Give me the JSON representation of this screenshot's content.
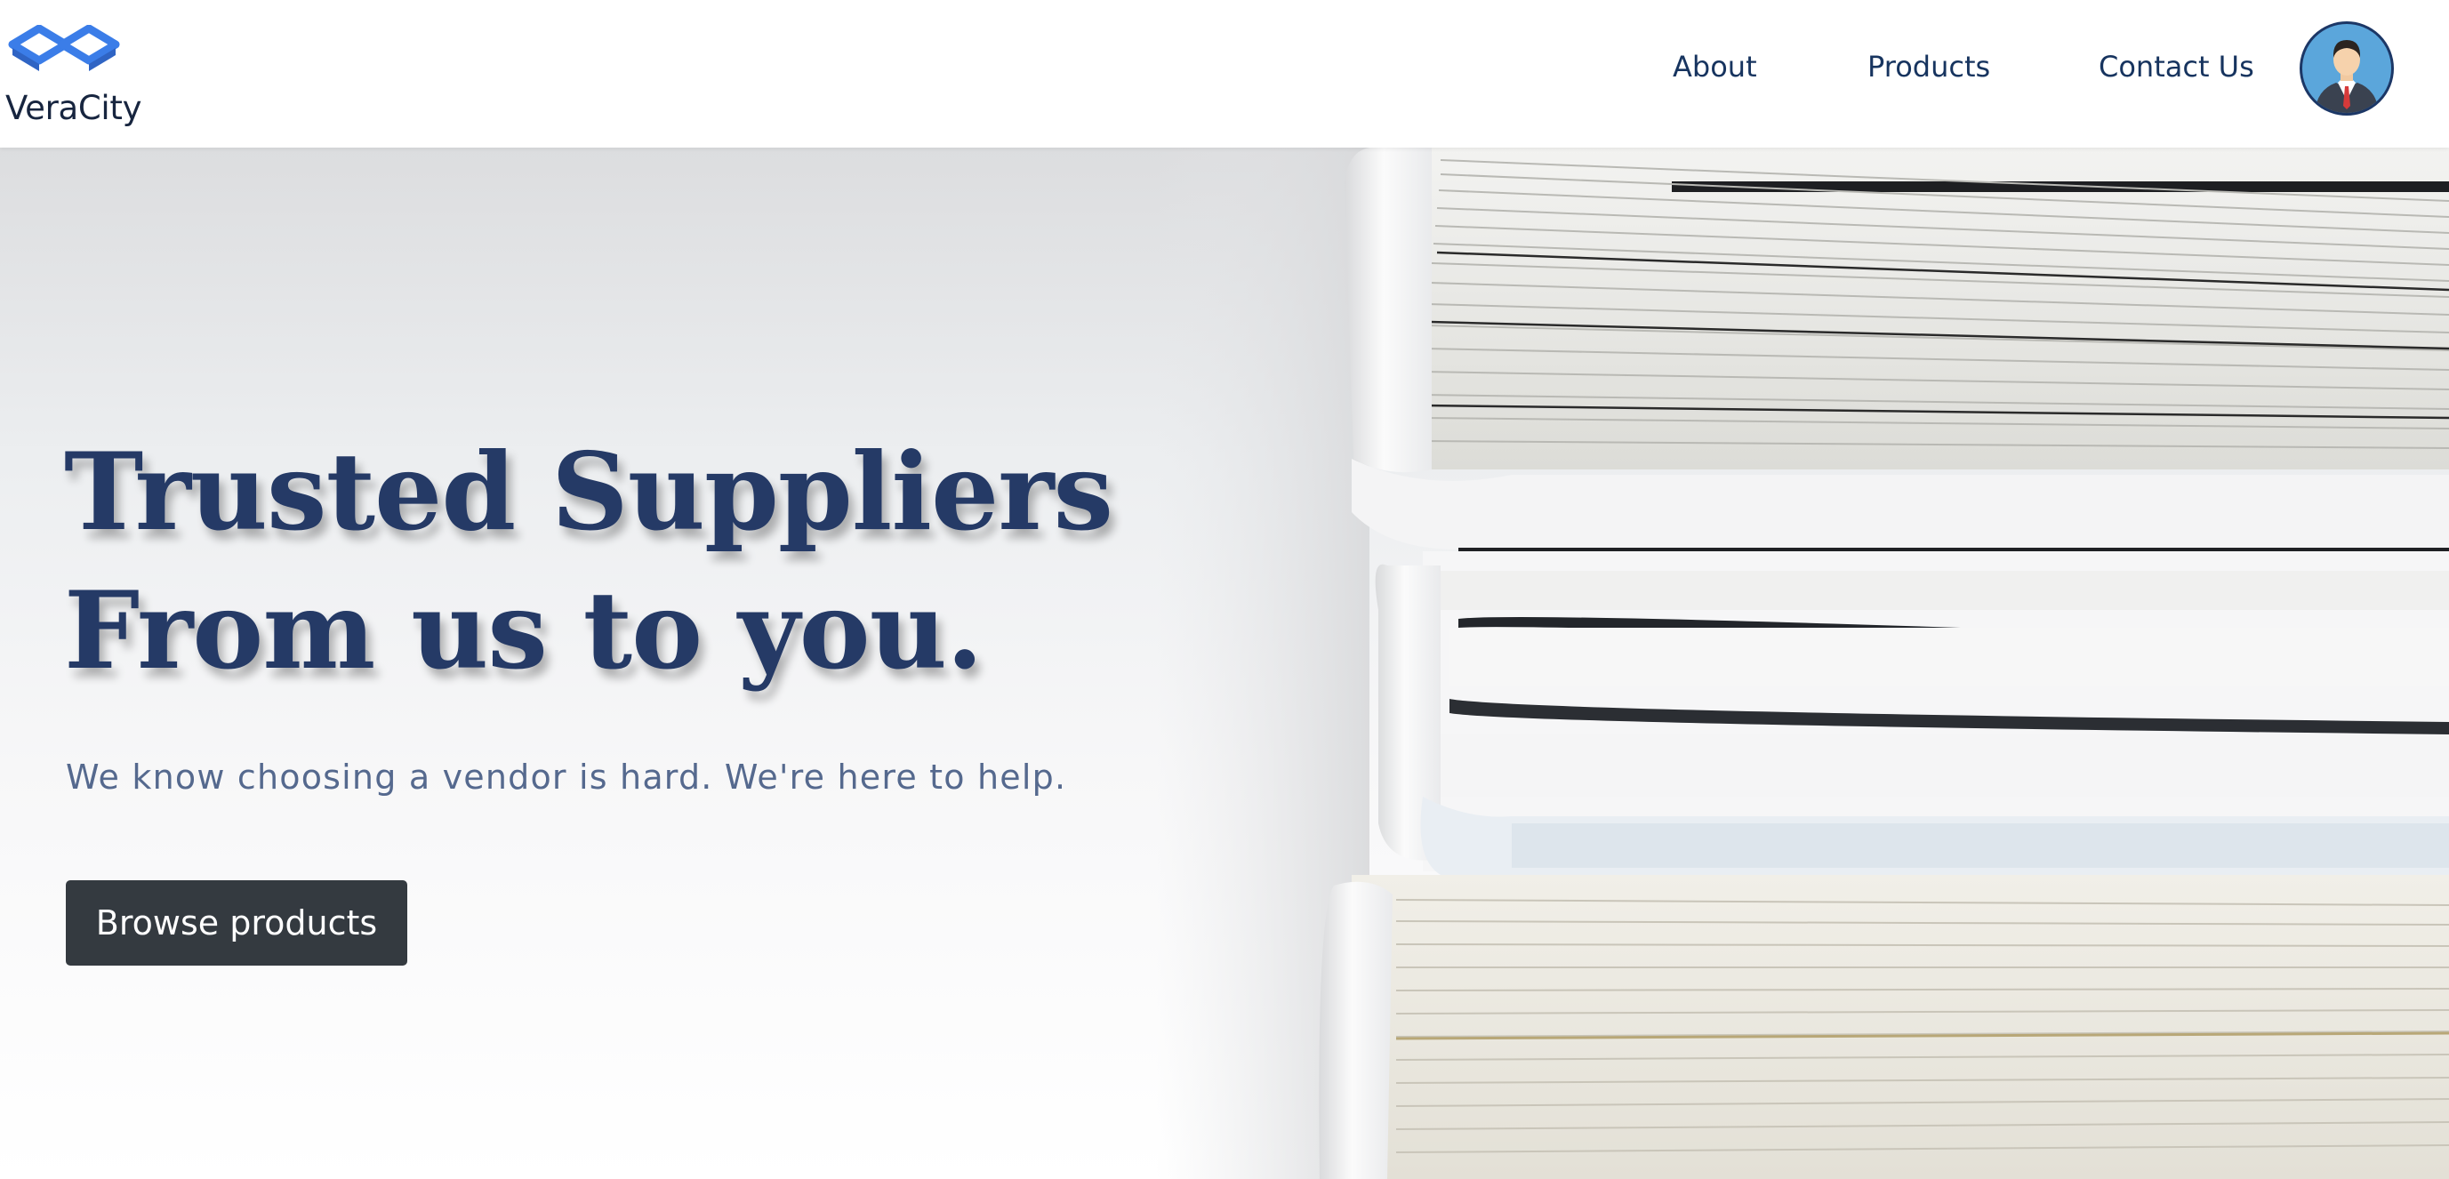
{
  "brand": {
    "name": "VeraCity",
    "logo_icon": "veracity-logo-icon",
    "logo_color": "#3b7de8"
  },
  "nav": {
    "items": [
      {
        "label": "About"
      },
      {
        "label": "Products"
      },
      {
        "label": "Contact Us"
      }
    ],
    "avatar_icon": "user-avatar-icon"
  },
  "hero": {
    "title_line1": "Trusted Suppliers",
    "title_line2": "From us to you.",
    "subtitle": "We know choosing a vendor is hard. We're here to help.",
    "cta_label": "Browse products",
    "background_image": "stacked-binders-photo"
  },
  "colors": {
    "heading": "#253a66",
    "subtitle": "#55698e",
    "nav_text": "#17345f",
    "button_bg": "#343a40",
    "avatar_bg": "#5ba6db"
  }
}
